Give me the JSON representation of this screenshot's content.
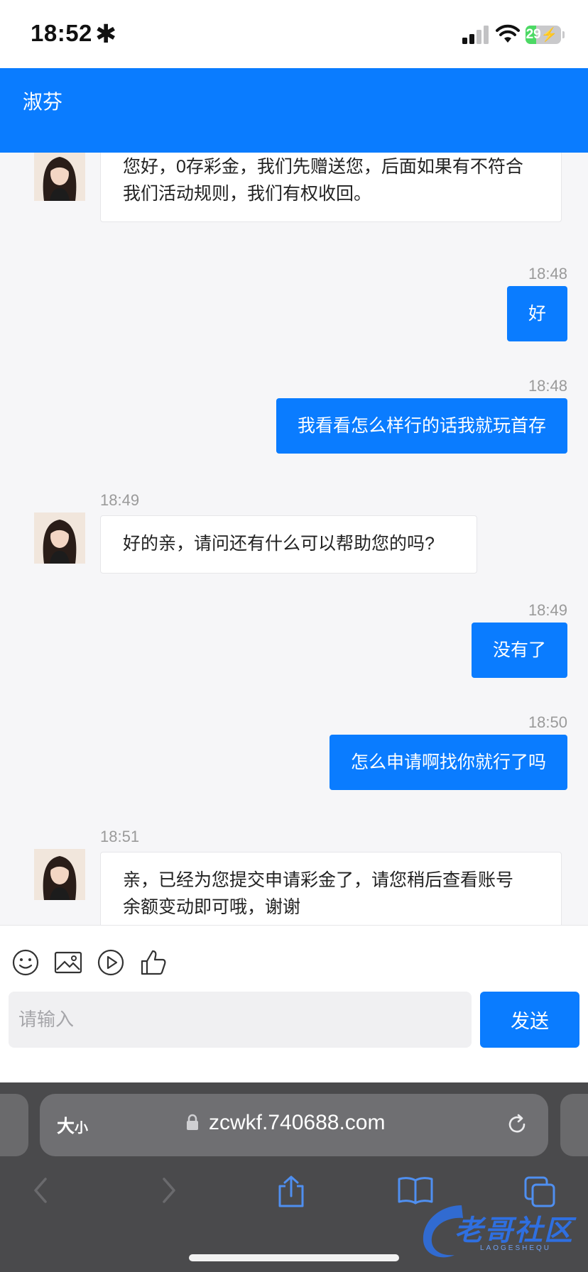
{
  "status_bar": {
    "time": "18:52",
    "battery": "29",
    "battery_level": 0.29
  },
  "chat": {
    "title": "淑芬",
    "messages": [
      {
        "side": "in",
        "time": "",
        "text_lines": [
          "您好，0存彩金，我们先赠送您，后面如果有不符合",
          "我们活动规则，我们有权收回。"
        ]
      },
      {
        "side": "out",
        "time": "18:48",
        "text": "好"
      },
      {
        "side": "out",
        "time": "18:48",
        "text": "我看看怎么样行的话我就玩首存"
      },
      {
        "side": "in",
        "time": "18:49",
        "text_lines": [
          "好的亲，请问还有什么可以帮助您的吗?"
        ]
      },
      {
        "side": "out",
        "time": "18:49",
        "text": "没有了"
      },
      {
        "side": "out",
        "time": "18:50",
        "text": "怎么申请啊找你就行了吗"
      },
      {
        "side": "in",
        "time": "18:51",
        "text_lines": [
          "亲，已经为您提交申请彩金了，请您稍后查看账号",
          "余额变动即可哦，谢谢"
        ]
      }
    ]
  },
  "composer": {
    "placeholder": "请输入",
    "send_label": "发送",
    "tools": [
      "emoji-icon",
      "image-icon",
      "video-icon",
      "like-icon"
    ]
  },
  "safari": {
    "text_size_big": "大",
    "text_size_small": "小",
    "url": "zcwkf.740688.com"
  },
  "watermark": {
    "text": "老哥社区",
    "sub": "LAOGESHEQU"
  },
  "colors": {
    "accent": "#0a7cff",
    "background": "#f6f6f8",
    "browser_chrome": "#4a4a4c"
  }
}
